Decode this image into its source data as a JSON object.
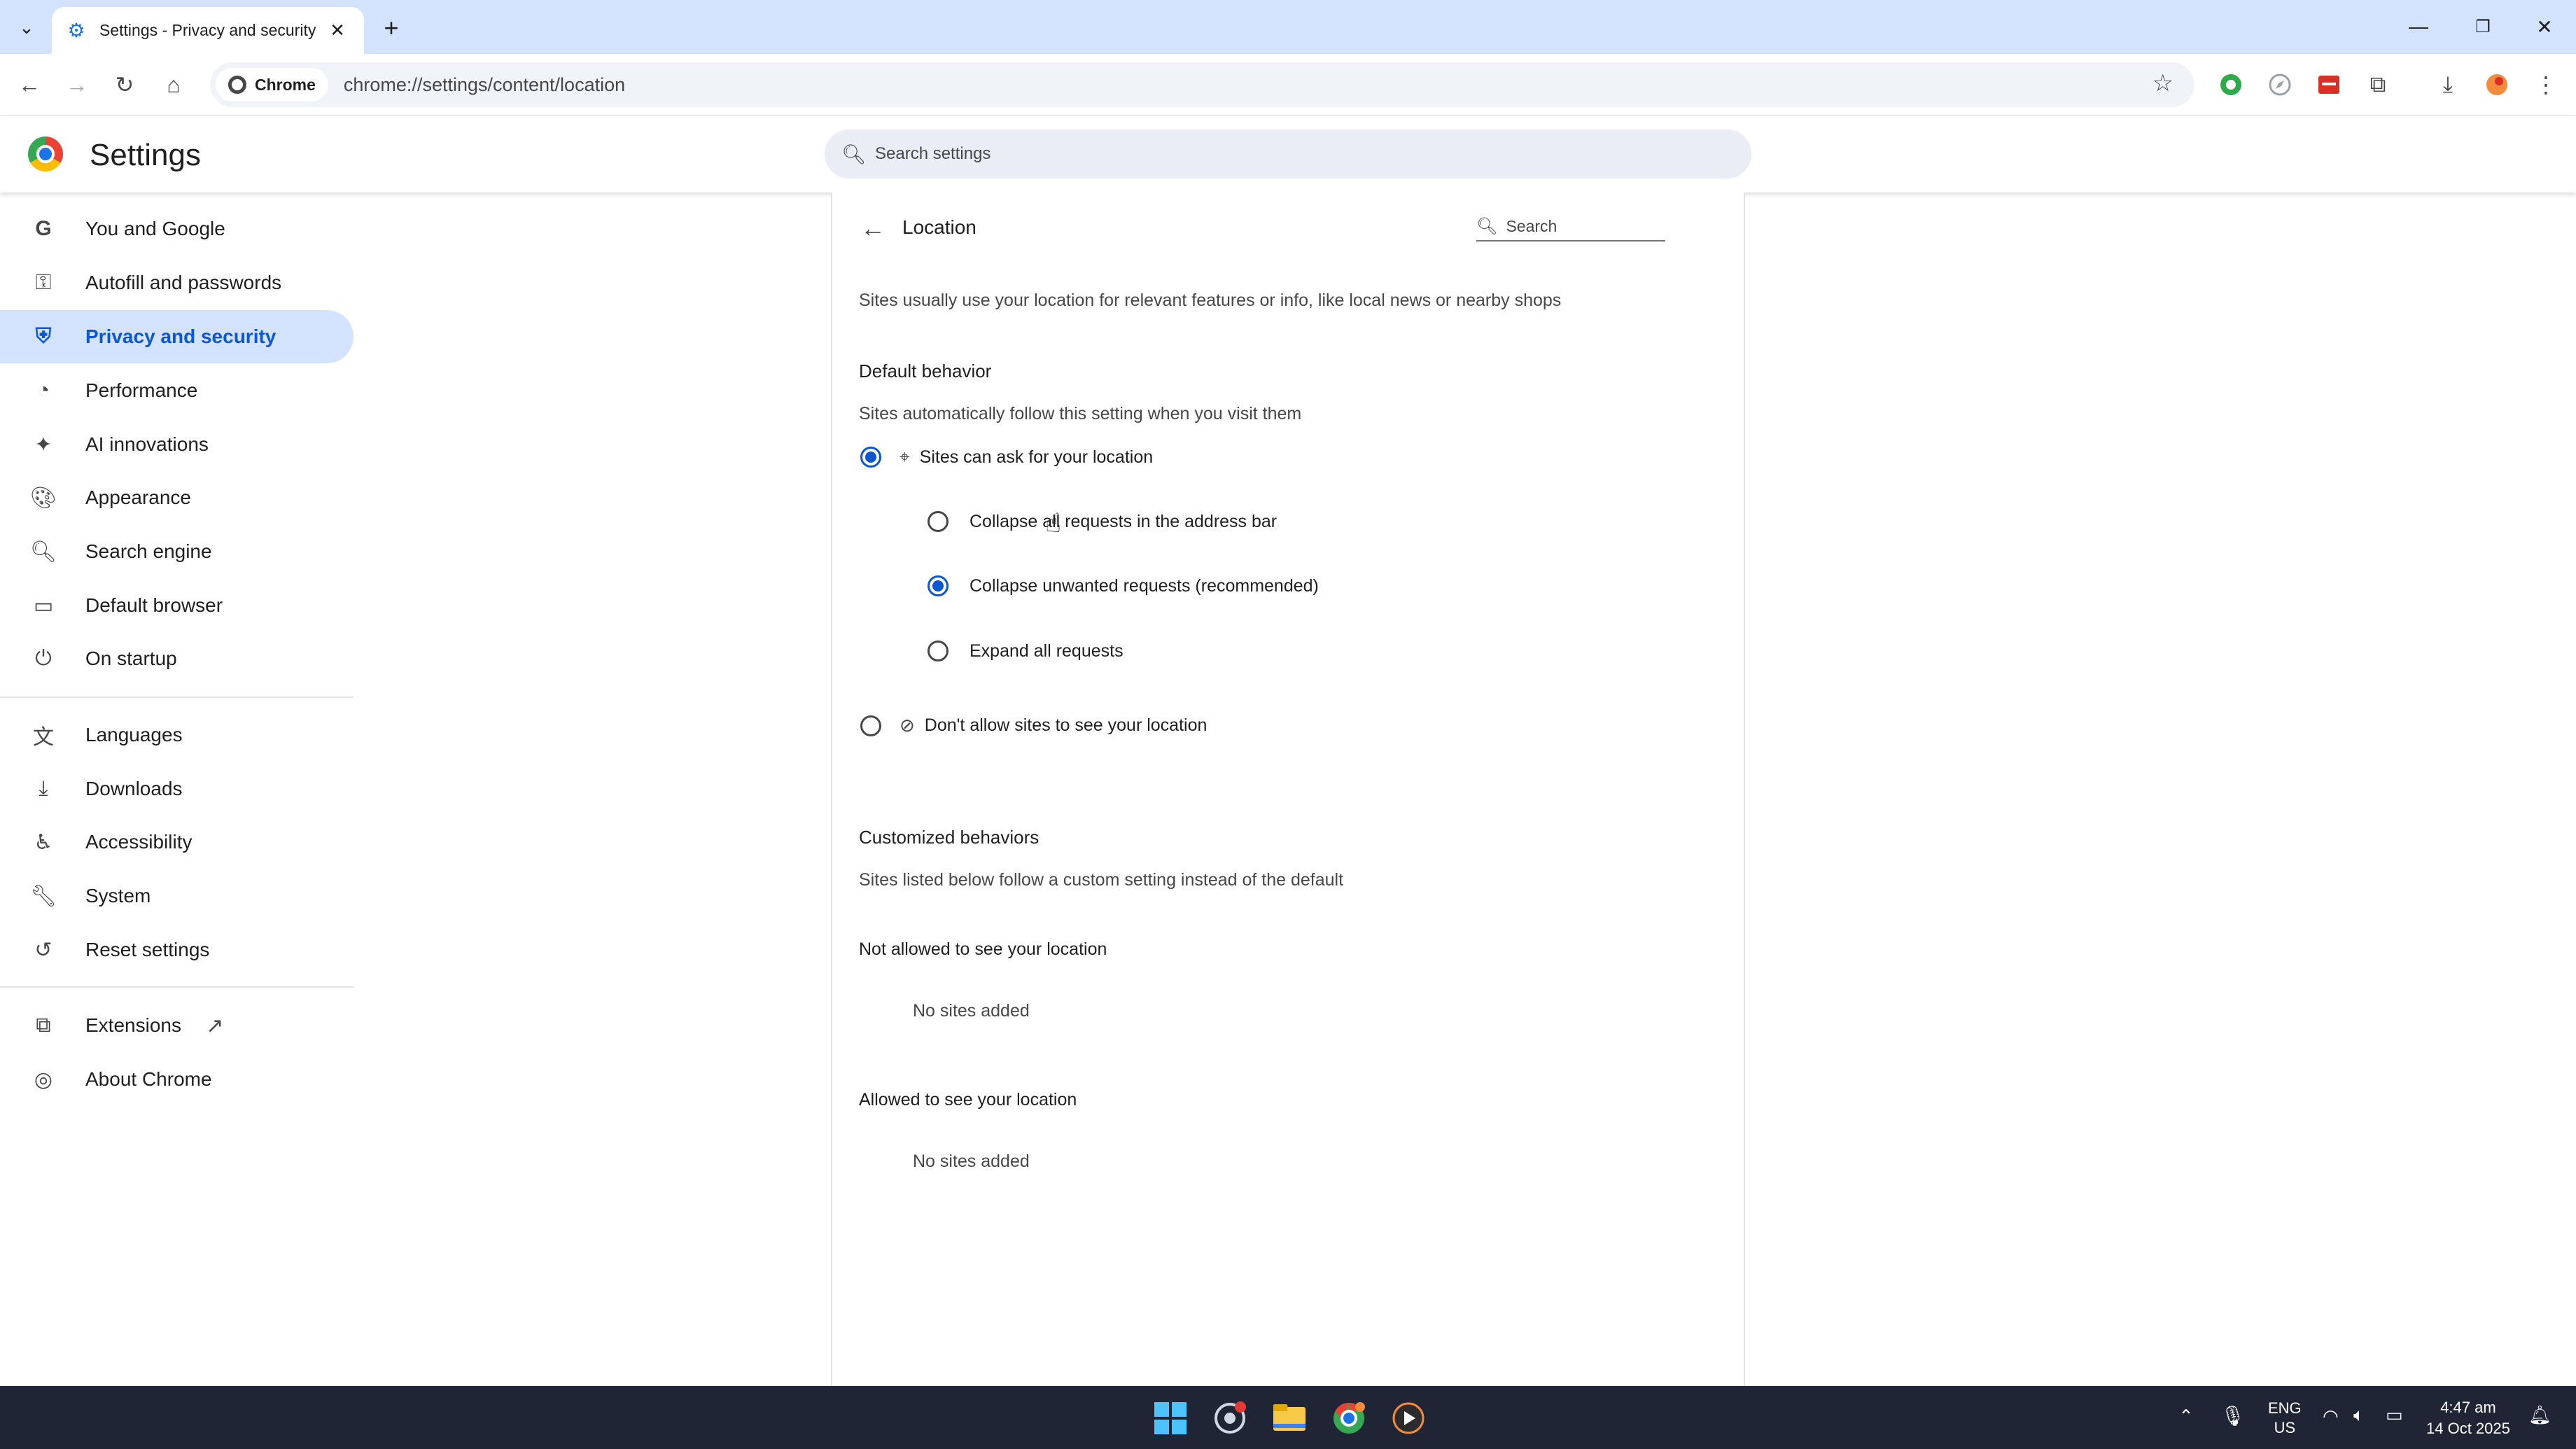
{
  "browser": {
    "tab_title": "Settings - Privacy and security",
    "url": "chrome://settings/content/location",
    "chip_label": "Chrome"
  },
  "settings": {
    "title": "Settings",
    "search_placeholder": "Search settings"
  },
  "sidebar": {
    "items": [
      {
        "label": "You and Google",
        "icon": "google-icon"
      },
      {
        "label": "Autofill and passwords",
        "icon": "key-icon"
      },
      {
        "label": "Privacy and security",
        "icon": "shield-icon",
        "active": true
      },
      {
        "label": "Performance",
        "icon": "gauge-icon"
      },
      {
        "label": "AI innovations",
        "icon": "sparkle-icon"
      },
      {
        "label": "Appearance",
        "icon": "palette-icon"
      },
      {
        "label": "Search engine",
        "icon": "search-icon"
      },
      {
        "label": "Default browser",
        "icon": "browser-window-icon"
      },
      {
        "label": "On startup",
        "icon": "power-icon"
      },
      {
        "label": "Languages",
        "icon": "translate-icon"
      },
      {
        "label": "Downloads",
        "icon": "download-icon"
      },
      {
        "label": "Accessibility",
        "icon": "accessibility-icon"
      },
      {
        "label": "System",
        "icon": "wrench-icon"
      },
      {
        "label": "Reset settings",
        "icon": "reset-icon"
      },
      {
        "label": "Extensions",
        "icon": "puzzle-icon"
      },
      {
        "label": "About Chrome",
        "icon": "chrome-icon"
      }
    ]
  },
  "location": {
    "title": "Location",
    "search_placeholder": "Search",
    "description": "Sites usually use your location for relevant features or info, like local news or nearby shops",
    "default_heading": "Default behavior",
    "default_sub": "Sites automatically follow this setting when you visit them",
    "allow_label": "Sites can ask for your location",
    "sub_options": [
      {
        "label": "Collapse all requests in the address bar",
        "selected": false
      },
      {
        "label": "Collapse unwanted requests (recommended)",
        "selected": true
      },
      {
        "label": "Expand all requests",
        "selected": false
      }
    ],
    "block_label": "Don't allow sites to see your location",
    "custom_heading": "Customized behaviors",
    "custom_sub": "Sites listed below follow a custom setting instead of the default",
    "not_allowed_heading": "Not allowed to see your location",
    "not_allowed_empty": "No sites added",
    "allowed_heading": "Allowed to see your location",
    "allowed_empty": "No sites added"
  },
  "taskbar": {
    "lang_top": "ENG",
    "lang_bottom": "US",
    "time": "4:47 am",
    "date": "14 Oct 2025"
  },
  "colors": {
    "accent": "#0b57d0",
    "tabbar": "#d3e3fd",
    "taskbar": "#1f2534"
  }
}
